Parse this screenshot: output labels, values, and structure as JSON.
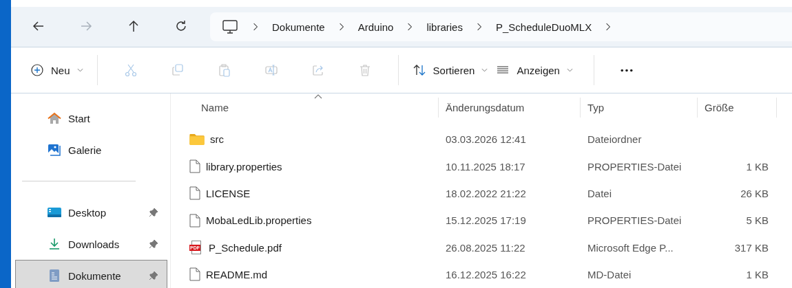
{
  "navigation": [
    {
      "kind": "back",
      "disabled": false
    },
    {
      "kind": "forward",
      "disabled": true
    },
    {
      "kind": "up",
      "disabled": false
    },
    {
      "kind": "refresh",
      "disabled": false
    }
  ],
  "address_bar": {
    "crumbs": [
      "Dokumente",
      "Arduino",
      "libraries",
      "P_ScheduleDuoMLX"
    ]
  },
  "toolbar": [
    {
      "kind": "new",
      "label": "Neu",
      "disabled": false
    },
    {
      "kind": "cut",
      "disabled": true
    },
    {
      "kind": "copy",
      "disabled": true
    },
    {
      "kind": "paste",
      "disabled": true
    },
    {
      "kind": "rename",
      "disabled": true
    },
    {
      "kind": "share",
      "disabled": true
    },
    {
      "kind": "delete",
      "disabled": true
    },
    {
      "kind": "sort",
      "label": "Sortieren",
      "disabled": false
    },
    {
      "kind": "view",
      "label": "Anzeigen",
      "disabled": false
    },
    {
      "kind": "more",
      "disabled": false
    }
  ],
  "sidebar": {
    "items": [
      {
        "kind": "home",
        "label": "Start",
        "pinned": false,
        "selected": false
      },
      {
        "kind": "gallery",
        "label": "Galerie",
        "pinned": false,
        "selected": false
      },
      {
        "kind": "separator"
      },
      {
        "kind": "desktop",
        "label": "Desktop",
        "pinned": true,
        "selected": false
      },
      {
        "kind": "downloads",
        "label": "Downloads",
        "pinned": true,
        "selected": false
      },
      {
        "kind": "documents",
        "label": "Dokumente",
        "pinned": true,
        "selected": true
      }
    ]
  },
  "table": {
    "columns": [
      "Name",
      "Änderungsdatum",
      "Typ",
      "Größe"
    ],
    "rows": [
      {
        "kind": "folder",
        "name": "src",
        "date": "03.03.2026 12:41",
        "type": "Dateiordner"
      },
      {
        "kind": "file",
        "name": "library.properties",
        "date": "10.11.2025 18:17",
        "type": "PROPERTIES-Datei",
        "size": "1 KB"
      },
      {
        "kind": "file",
        "name": "LICENSE",
        "date": "18.02.2022 21:22",
        "type": "Datei",
        "size": "26 KB"
      },
      {
        "kind": "file",
        "name": "MobaLedLib.properties",
        "date": "15.12.2025 17:19",
        "type": "PROPERTIES-Datei",
        "size": "5 KB"
      },
      {
        "kind": "pdf",
        "icon_text": "PDF",
        "name": "P_Schedule.pdf",
        "date": "26.08.2025 11:22",
        "type": "Microsoft Edge P...",
        "size": "317 KB"
      },
      {
        "kind": "file",
        "name": "README.md",
        "date": "16.12.2025 16:22",
        "type": "MD-Datei",
        "size": "1 KB"
      }
    ]
  }
}
